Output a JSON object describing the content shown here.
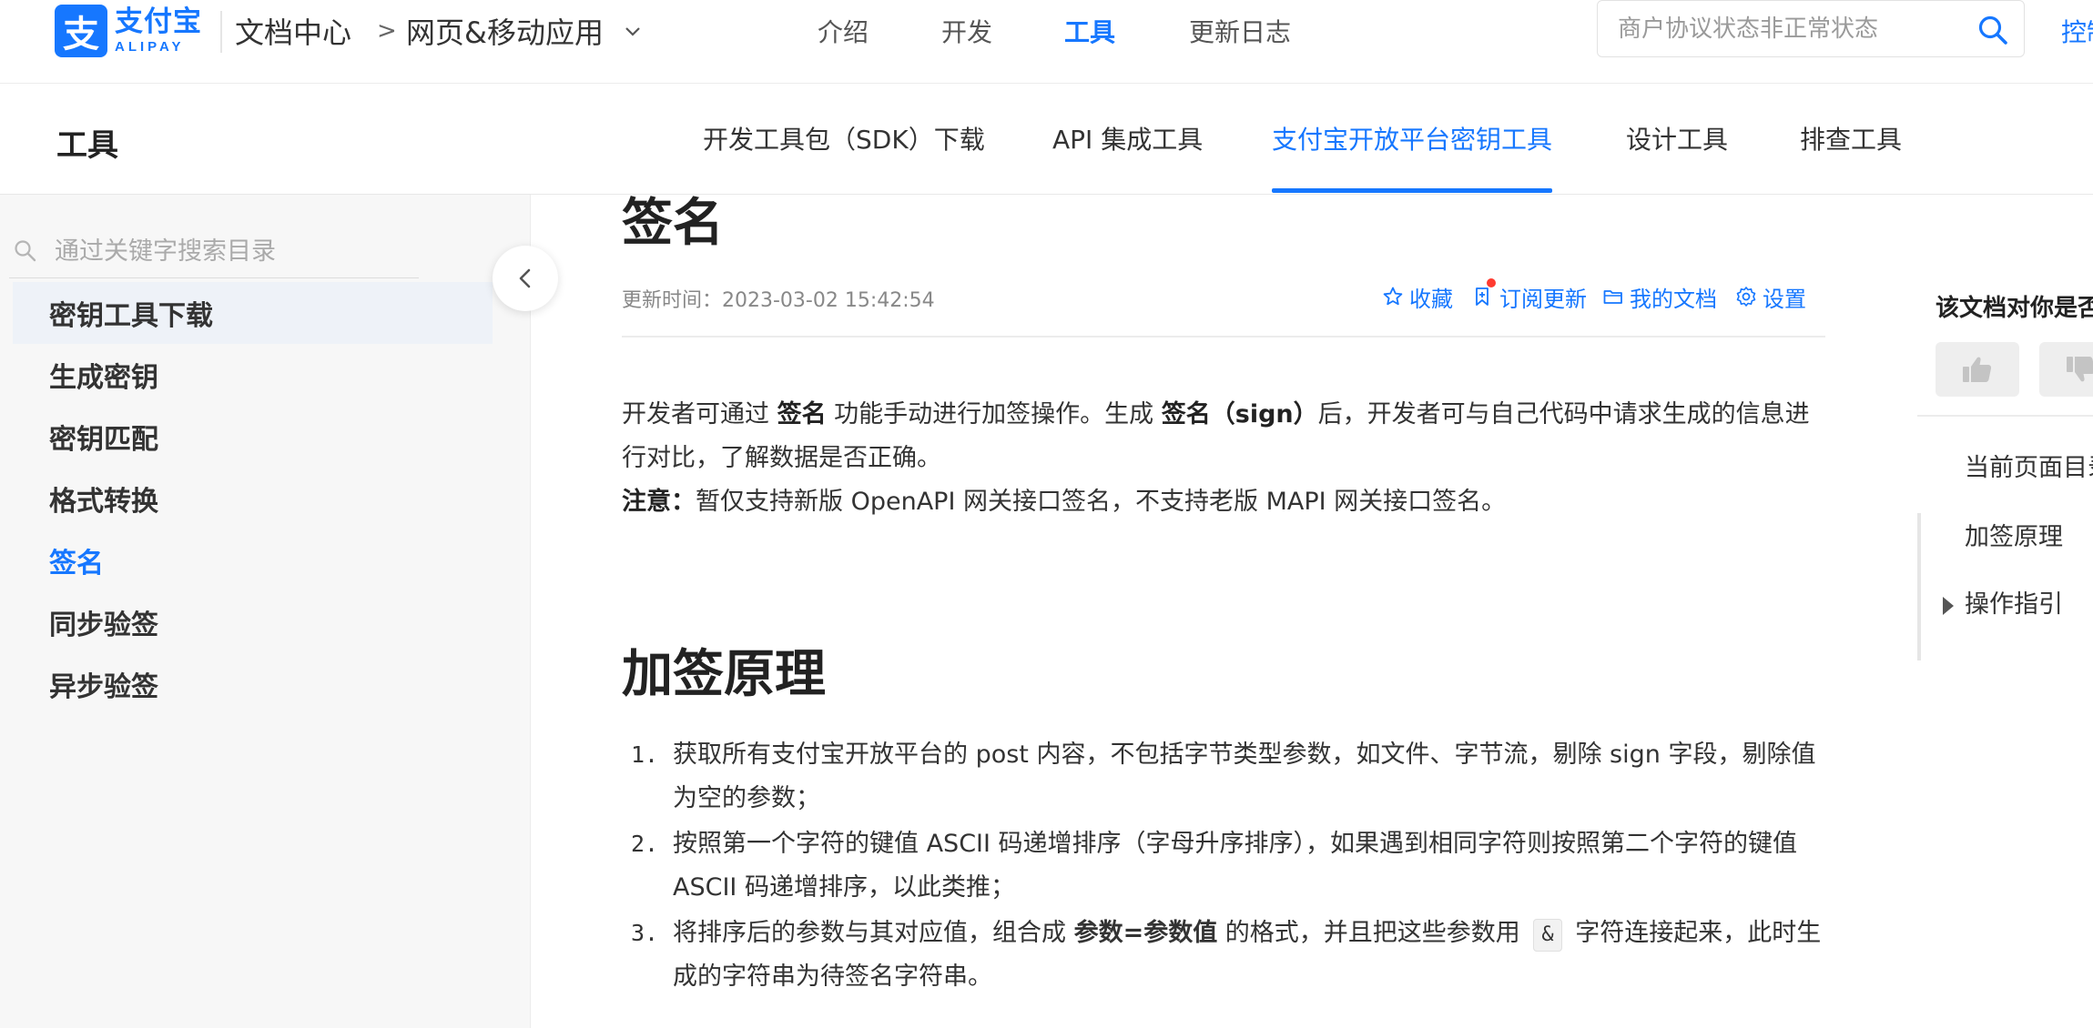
{
  "header": {
    "logo_mark": "支",
    "logo_cn": "支付宝",
    "logo_en": "ALIPAY",
    "breadcrumb_docs": "文档中心",
    "breadcrumb_arrow": ">",
    "breadcrumb_product": "网页&移动应用",
    "nav": [
      {
        "label": "介绍",
        "active": false
      },
      {
        "label": "开发",
        "active": false
      },
      {
        "label": "工具",
        "active": true
      },
      {
        "label": "更新日志",
        "active": false
      }
    ],
    "search_placeholder": "商户协议状态非正常状态",
    "console_label": "控制台"
  },
  "subheader": {
    "title": "工具",
    "tabs": [
      {
        "label": "开发工具包（SDK）下载",
        "active": false
      },
      {
        "label": "API 集成工具",
        "active": false
      },
      {
        "label": "支付宝开放平台密钥工具",
        "active": true
      },
      {
        "label": "设计工具",
        "active": false
      },
      {
        "label": "排查工具",
        "active": false
      }
    ]
  },
  "sidebar": {
    "search_placeholder": "通过关键字搜索目录",
    "items": [
      {
        "label": "密钥工具下载",
        "state": "hover"
      },
      {
        "label": "生成密钥",
        "state": ""
      },
      {
        "label": "密钥匹配",
        "state": ""
      },
      {
        "label": "格式转换",
        "state": ""
      },
      {
        "label": "签名",
        "state": "active"
      },
      {
        "label": "同步验签",
        "state": ""
      },
      {
        "label": "异步验签",
        "state": ""
      }
    ]
  },
  "main": {
    "title": "签名",
    "updated": "更新时间：2023-03-02 15:42:54",
    "actions": {
      "favorite": "收藏",
      "subscribe": "订阅更新",
      "my_docs": "我的文档",
      "settings": "设置"
    },
    "intro": {
      "p1_a": "开发者可通过 ",
      "p1_b": "签名",
      "p1_c": " 功能手动进行加签操作。生成 ",
      "p1_d": "签名（sign）",
      "p1_e": "后，开发者可与自己代码中请求生成的信息进行对比，了解数据是否正确。",
      "note_label": "注意：",
      "note_text": "暂仅支持新版 OpenAPI 网关接口签名，不支持老版 MAPI 网关接口签名。"
    },
    "section_title": "加签原理",
    "steps": [
      {
        "num": "1.",
        "text": "获取所有支付宝开放平台的 post 内容，不包括字节类型参数，如文件、字节流，剔除 sign 字段，剔除值为空的参数；"
      },
      {
        "num": "2.",
        "text": "按照第一个字符的键值 ASCII 码递增排序（字母升序排序），如果遇到相同字符则按照第二个字符的键值 ASCII 码递增排序，以此类推；"
      },
      {
        "num": "3.",
        "text_a": "将排序后的参数与其对应值，组合成 ",
        "bold": "参数=参数值",
        "text_b": " 的格式，并且把这些参数用 ",
        "code": "&",
        "text_c": " 字符连接起来，此时生成的字符串为待签名字符串。"
      }
    ]
  },
  "right_panel": {
    "feedback_question": "该文档对你是否有帮助？",
    "toc": [
      {
        "label": "当前页面目录"
      },
      {
        "label": "加签原理"
      },
      {
        "label": "操作指引"
      }
    ]
  }
}
